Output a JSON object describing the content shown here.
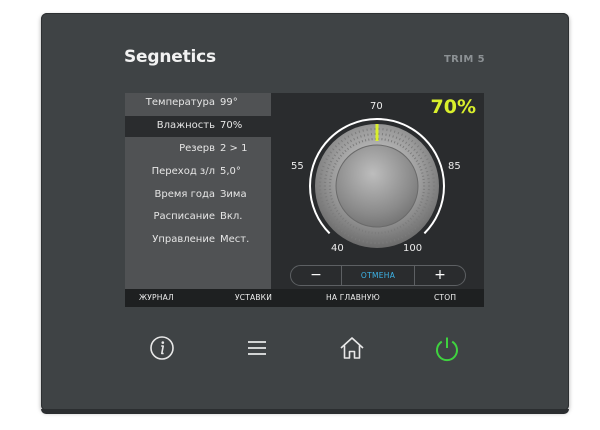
{
  "device": {
    "brand": "Segnetics",
    "model": "TRIM 5"
  },
  "params": [
    {
      "label": "Температура",
      "value": "99°",
      "selected": false
    },
    {
      "label": "Влажность",
      "value": "70%",
      "selected": true
    },
    {
      "label": "Резерв",
      "value": "2 > 1",
      "selected": false
    },
    {
      "label": "Переход з/л",
      "value": "5,0°",
      "selected": false
    },
    {
      "label": "Время года",
      "value": "Зима",
      "selected": false
    },
    {
      "label": "Расписание",
      "value": "Вкл.",
      "selected": false
    },
    {
      "label": "Управление",
      "value": "Мест.",
      "selected": false
    }
  ],
  "dial": {
    "current": "70%",
    "current_value": 70,
    "min": 40,
    "max": 100,
    "scale_labels": [
      "40",
      "55",
      "70",
      "85",
      "100"
    ],
    "accent": "#d9ef2c"
  },
  "controls": {
    "minus": "−",
    "cancel": "ОТМЕНА",
    "plus": "+"
  },
  "softkeys": [
    "ЖУРНАЛ",
    "УСТАВКИ",
    "НА ГЛАВНУЮ",
    "СТОП"
  ],
  "hardware_buttons": [
    {
      "icon": "info-icon",
      "color": "#e8e8e8"
    },
    {
      "icon": "menu-icon",
      "color": "#e8e8e8"
    },
    {
      "icon": "home-icon",
      "color": "#e8e8e8"
    },
    {
      "icon": "power-icon",
      "color": "#3fd23f"
    }
  ]
}
